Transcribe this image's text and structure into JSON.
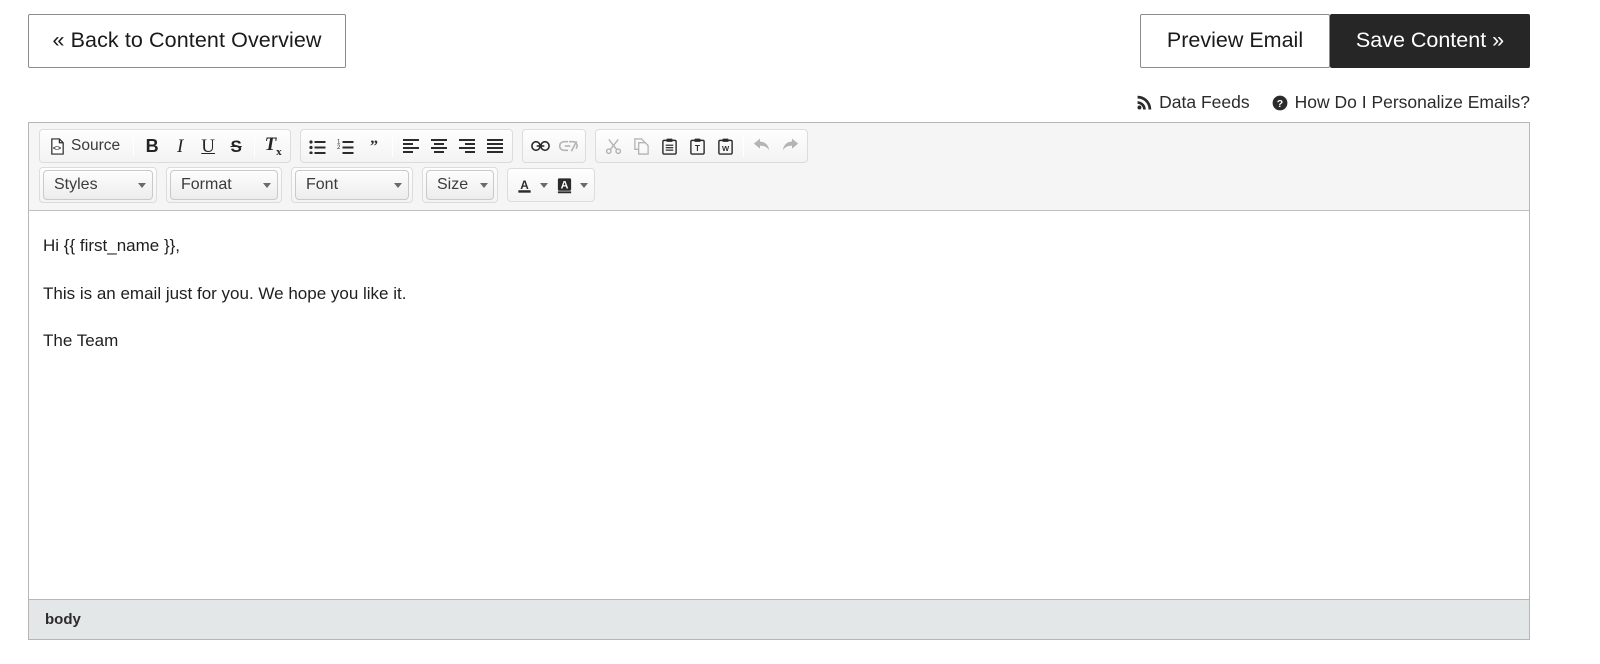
{
  "topbar": {
    "back_button": "« Back to Content Overview",
    "preview_button": "Preview Email",
    "save_button": "Save Content »"
  },
  "helper_links": [
    {
      "icon": "rss-icon",
      "label": "Data Feeds"
    },
    {
      "icon": "question-circle-icon",
      "label": "How Do I Personalize Emails?"
    }
  ],
  "editor": {
    "toolbar": {
      "row1": [
        {
          "group": "document",
          "buttons": [
            {
              "name": "source-button",
              "label": "Source",
              "icon": "source-code-icon",
              "disabled": false
            }
          ]
        },
        {
          "group": "basic-styles",
          "buttons": [
            {
              "name": "bold-button",
              "label": "B",
              "icon": "bold-icon",
              "disabled": false
            },
            {
              "name": "italic-button",
              "label": "I",
              "icon": "italic-icon",
              "disabled": false
            },
            {
              "name": "underline-button",
              "label": "U",
              "icon": "underline-icon",
              "disabled": false
            },
            {
              "name": "strikethrough-button",
              "label": "S",
              "icon": "strikethrough-icon",
              "disabled": false
            },
            {
              "name": "remove-format-button",
              "label": "Tx",
              "icon": "remove-format-icon",
              "disabled": false
            }
          ]
        },
        {
          "group": "paragraph",
          "buttons": [
            {
              "name": "bulleted-list-button",
              "icon": "bulleted-list-icon",
              "disabled": false
            },
            {
              "name": "numbered-list-button",
              "icon": "numbered-list-icon",
              "disabled": false
            },
            {
              "name": "blockquote-button",
              "icon": "blockquote-icon",
              "disabled": false
            },
            {
              "name": "align-left-button",
              "icon": "align-left-icon",
              "disabled": false
            },
            {
              "name": "align-center-button",
              "icon": "align-center-icon",
              "disabled": false
            },
            {
              "name": "align-right-button",
              "icon": "align-right-icon",
              "disabled": false
            },
            {
              "name": "align-justify-button",
              "icon": "align-justify-icon",
              "disabled": false
            }
          ]
        },
        {
          "group": "links",
          "buttons": [
            {
              "name": "link-button",
              "icon": "link-icon",
              "disabled": false
            },
            {
              "name": "unlink-button",
              "icon": "unlink-icon",
              "disabled": true
            }
          ]
        },
        {
          "group": "clipboard",
          "buttons": [
            {
              "name": "cut-button",
              "icon": "scissors-icon",
              "disabled": true
            },
            {
              "name": "copy-button",
              "icon": "copy-icon",
              "disabled": true
            },
            {
              "name": "paste-button",
              "icon": "paste-icon",
              "disabled": false
            },
            {
              "name": "paste-as-plain-text-button",
              "icon": "paste-text-icon",
              "disabled": false
            },
            {
              "name": "paste-from-word-button",
              "icon": "paste-word-icon",
              "disabled": false
            },
            {
              "name": "undo-button",
              "icon": "undo-arrow-icon",
              "disabled": true
            },
            {
              "name": "redo-button",
              "icon": "redo-arrow-icon",
              "disabled": true
            }
          ]
        }
      ],
      "row2": {
        "styles_select": "Styles",
        "format_select": "Format",
        "font_select": "Font",
        "size_select": "Size",
        "text_color_button": "text-color-icon",
        "background_color_button": "background-color-icon"
      }
    },
    "body_paragraphs": [
      "Hi {{ first_name }},",
      "This is an email just for you. We hope you like it.",
      "The Team"
    ],
    "status_element_path": "body"
  },
  "colors": {
    "save_button_bg": "#262626",
    "toolbar_bg": "#f5f5f5",
    "statusbar_bg": "#e4e7e7",
    "border": "#b6b6b6"
  }
}
